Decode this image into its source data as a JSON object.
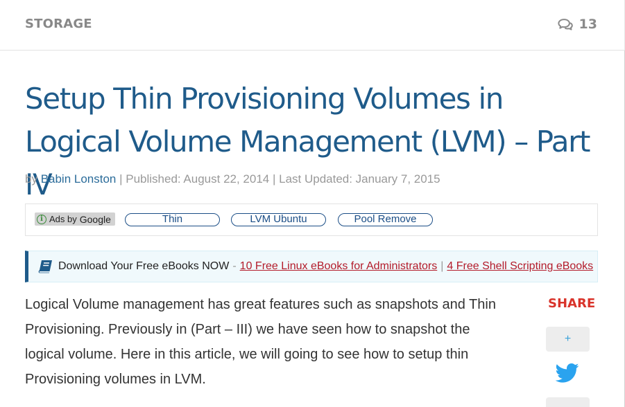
{
  "header": {
    "category": "STORAGE",
    "comment_count": "13",
    "comment_icon": "comments-icon"
  },
  "article": {
    "title": "Setup Thin Provisioning Volumes in Logical Volume Management (LVM) – Part IV",
    "meta": {
      "by_prefix": "by ",
      "author": "Babin Lonston",
      "published": " | Published: August 22, 2014 | Last Updated: January 7, 2015"
    },
    "intro": "Logical Volume management has great features such as snapshots and Thin Provisioning. Previously in (Part – III) we have seen how to snapshot the logical volume. Here in this article, we will going to see how to setup thin Provisioning volumes in LVM."
  },
  "ads": {
    "ads_by": "Ads by",
    "google": "Google",
    "links": [
      "Thin",
      "LVM Ubuntu",
      "Pool Remove"
    ]
  },
  "promo": {
    "icon": "book-icon",
    "lead": "Download Your Free eBooks NOW",
    "dash": "-",
    "link1": "10 Free Linux eBooks for Administrators",
    "separator": "|",
    "link2": "4 Free Shell Scripting eBooks"
  },
  "share": {
    "title": "SHARE",
    "plus": "+",
    "twitter_icon": "twitter-icon"
  },
  "colors": {
    "title": "#1f5b8a",
    "link_red": "#b31b2a",
    "share_red": "#d9342b",
    "promo_bg": "#f0f9fc",
    "twitter": "#2aa3ef"
  }
}
